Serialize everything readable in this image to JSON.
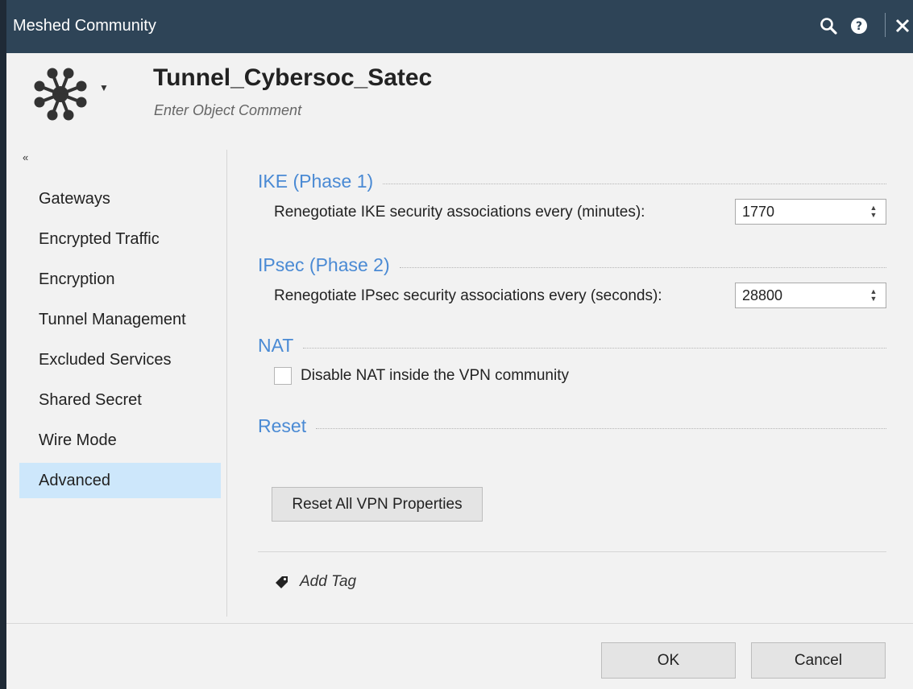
{
  "window": {
    "title": "Meshed Community",
    "icons": [
      "search-icon",
      "help-icon",
      "close-icon"
    ]
  },
  "header": {
    "object_name": "Tunnel_Cybersoc_Satec",
    "comment_placeholder": "Enter Object Comment",
    "logo_icon": "meshed-community-icon"
  },
  "sidebar": {
    "collapse_glyph": "«",
    "items": [
      {
        "label": "Gateways"
      },
      {
        "label": "Encrypted Traffic"
      },
      {
        "label": "Encryption"
      },
      {
        "label": "Tunnel Management"
      },
      {
        "label": "Excluded Services"
      },
      {
        "label": "Shared Secret"
      },
      {
        "label": "Wire Mode"
      },
      {
        "label": "Advanced",
        "selected": true
      }
    ]
  },
  "sections": {
    "ike": {
      "title": "IKE (Phase 1)",
      "label": "Renegotiate IKE security associations every (minutes):",
      "value": "1770"
    },
    "ipsec": {
      "title": "IPsec (Phase 2)",
      "label": "Renegotiate IPsec security associations every (seconds):",
      "value": "28800"
    },
    "nat": {
      "title": "NAT",
      "checkbox_label": "Disable NAT inside the VPN community",
      "checked": false
    },
    "reset": {
      "title": "Reset",
      "button_label": "Reset All VPN Properties"
    }
  },
  "tags": {
    "add_label": "Add Tag"
  },
  "footer": {
    "ok_label": "OK",
    "cancel_label": "Cancel"
  },
  "colors": {
    "titlebar": "#2e4457",
    "section_title": "#4a8ad4",
    "selected_nav": "#cde7fb"
  }
}
